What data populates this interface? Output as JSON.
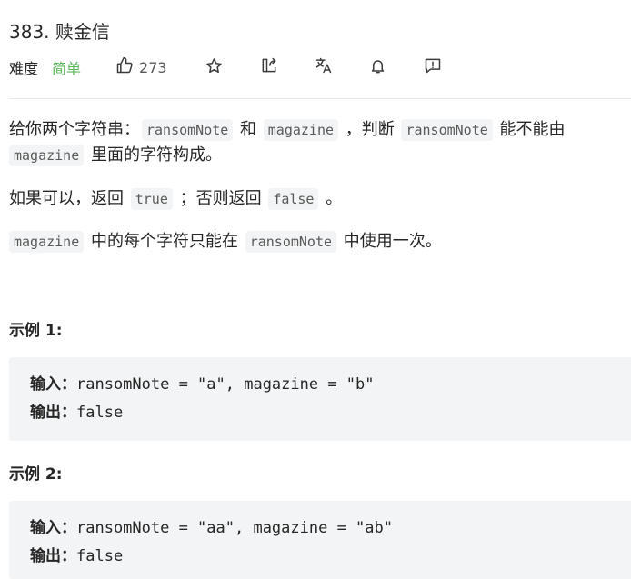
{
  "problem": {
    "title": "383. 赎金信",
    "difficulty_label": "难度",
    "difficulty_value": "简单",
    "likes": "273"
  },
  "toolbar": {
    "icons": [
      "thumbs-up-icon",
      "star-icon",
      "share-icon",
      "translate-icon",
      "bell-icon",
      "feedback-icon"
    ]
  },
  "description": {
    "p1_a": "给你两个字符串：",
    "p1_code1": "ransomNote",
    "p1_b": " 和 ",
    "p1_code2": "magazine",
    "p1_c": " ，判断 ",
    "p1_code3": "ransomNote",
    "p1_d": " 能不能由",
    "p1_code4": "magazine",
    "p1_e": " 里面的字符构成。",
    "p2_a": "如果可以，返回 ",
    "p2_code1": "true",
    "p2_b": " ；否则返回 ",
    "p2_code2": "false",
    "p2_c": " 。",
    "p3_code1": "magazine",
    "p3_a": " 中的每个字符只能在 ",
    "p3_code2": "ransomNote",
    "p3_b": " 中使用一次。"
  },
  "examples": [
    {
      "title": "示例 1:",
      "input_label": "输入：",
      "input_value": "ransomNote = \"a\", magazine = \"b\"",
      "output_label": "输出：",
      "output_value": "false"
    },
    {
      "title": "示例 2:",
      "input_label": "输入：",
      "input_value": "ransomNote = \"aa\", magazine = \"ab\"",
      "output_label": "输出：",
      "output_value": "false"
    }
  ],
  "colors": {
    "easy": "#5cb85c",
    "code_bg": "#f3f4f5",
    "text": "#262626"
  }
}
